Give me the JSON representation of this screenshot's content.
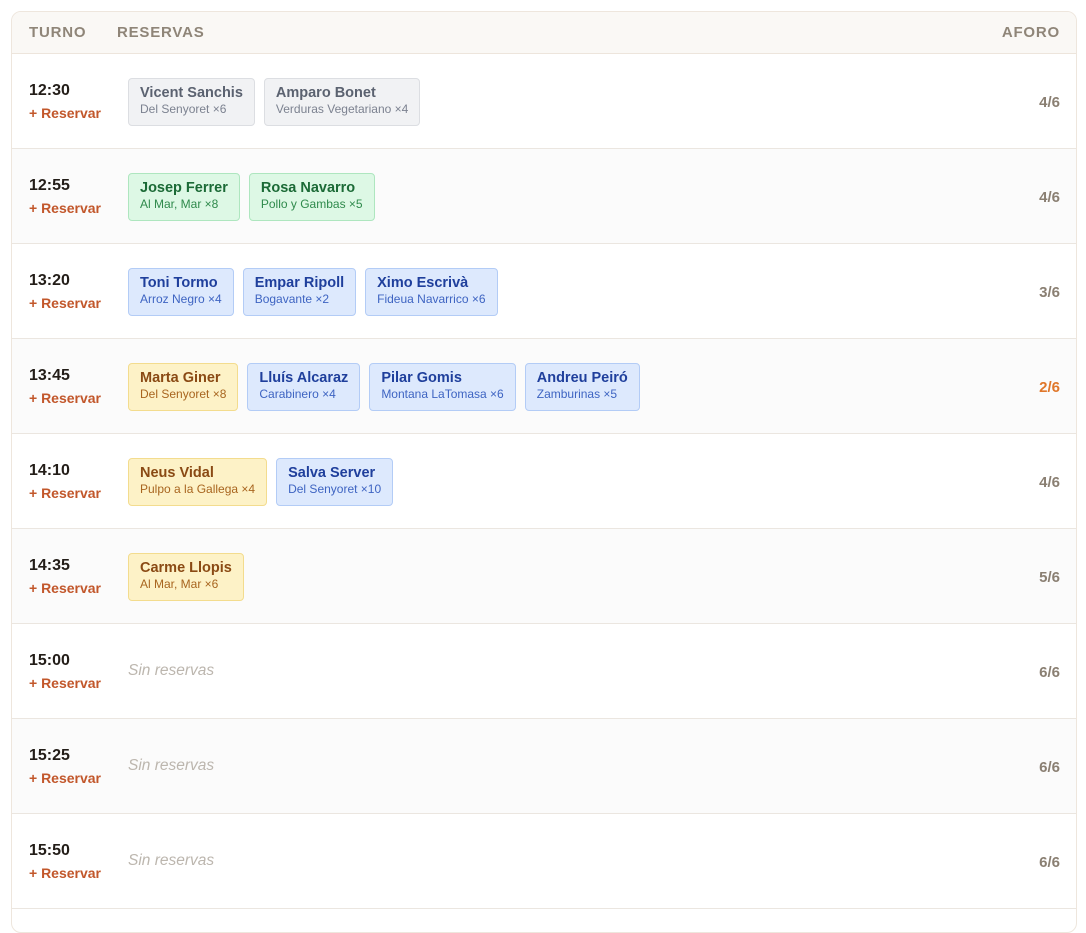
{
  "header": {
    "turno": "TURNO",
    "reservas": "RESERVAS",
    "aforo": "AFORO"
  },
  "reservar_label": "+ Reservar",
  "empty_label": "Sin reservas",
  "rows": [
    {
      "time": "12:30",
      "aforo": "4/6",
      "reservations": [
        {
          "name": "Vicent Sanchis",
          "detail": "Del Senyoret ×6",
          "color": "gray"
        },
        {
          "name": "Amparo Bonet",
          "detail": "Verduras Vegetariano ×4",
          "color": "gray"
        }
      ]
    },
    {
      "time": "12:55",
      "aforo": "4/6",
      "reservations": [
        {
          "name": "Josep Ferrer",
          "detail": "Al Mar, Mar ×8",
          "color": "green"
        },
        {
          "name": "Rosa Navarro",
          "detail": "Pollo y Gambas ×5",
          "color": "green"
        }
      ]
    },
    {
      "time": "13:20",
      "aforo": "3/6",
      "reservations": [
        {
          "name": "Toni Tormo",
          "detail": "Arroz Negro ×4",
          "color": "blue"
        },
        {
          "name": "Empar Ripoll",
          "detail": "Bogavante ×2",
          "color": "blue"
        },
        {
          "name": "Ximo Escrivà",
          "detail": "Fideua Navarrico ×6",
          "color": "blue"
        }
      ]
    },
    {
      "time": "13:45",
      "aforo": "2/6",
      "warn": true,
      "reservations": [
        {
          "name": "Marta Giner",
          "detail": "Del Senyoret ×8",
          "color": "yellow"
        },
        {
          "name": "Lluís Alcaraz",
          "detail": "Carabinero ×4",
          "color": "blue"
        },
        {
          "name": "Pilar Gomis",
          "detail": "Montana LaTomasa ×6",
          "color": "blue"
        },
        {
          "name": "Andreu Peiró",
          "detail": "Zamburinas ×5",
          "color": "blue"
        }
      ]
    },
    {
      "time": "14:10",
      "aforo": "4/6",
      "reservations": [
        {
          "name": "Neus Vidal",
          "detail": "Pulpo a la Gallega ×4",
          "color": "yellow"
        },
        {
          "name": "Salva Server",
          "detail": "Del Senyoret ×10",
          "color": "blue"
        }
      ]
    },
    {
      "time": "14:35",
      "aforo": "5/6",
      "reservations": [
        {
          "name": "Carme Llopis",
          "detail": "Al Mar, Mar ×6",
          "color": "yellow"
        }
      ]
    },
    {
      "time": "15:00",
      "aforo": "6/6",
      "reservations": []
    },
    {
      "time": "15:25",
      "aforo": "6/6",
      "reservations": []
    },
    {
      "time": "15:50",
      "aforo": "6/6",
      "reservations": []
    }
  ]
}
